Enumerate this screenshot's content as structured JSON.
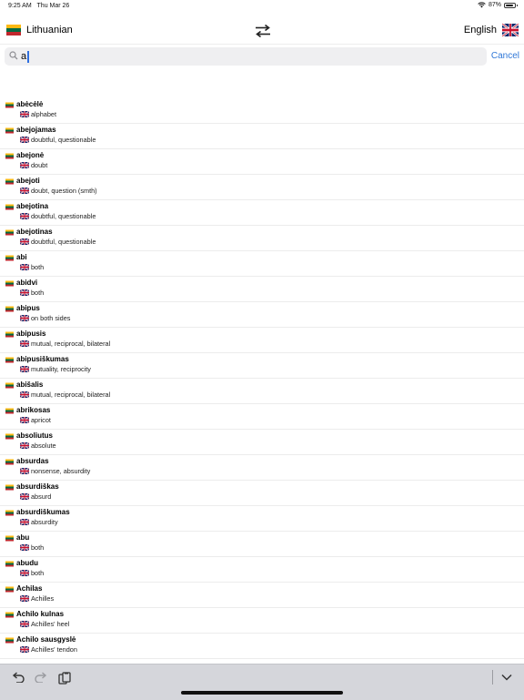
{
  "status_bar": {
    "time": "9:25 AM",
    "date": "Thu Mar 26",
    "battery": "87%",
    "battery_level": 0.87
  },
  "header": {
    "source_language": "Lithuanian",
    "target_language": "English",
    "swap_icon": "swap-arrows-icon"
  },
  "search": {
    "query": "a",
    "cancel_label": "Cancel",
    "icon": "search-icon"
  },
  "results": [
    {
      "term": "abėcėlė",
      "translation": "alphabet"
    },
    {
      "term": "abejojamas",
      "translation": "doubtful, questionable"
    },
    {
      "term": "abejonė",
      "translation": "doubt"
    },
    {
      "term": "abejoti",
      "translation": "doubt, question (smth)"
    },
    {
      "term": "abejotina",
      "translation": "doubtful, questionable"
    },
    {
      "term": "abejotinas",
      "translation": "doubtful, questionable"
    },
    {
      "term": "abi",
      "translation": "both"
    },
    {
      "term": "abidvi",
      "translation": "both"
    },
    {
      "term": "abipus",
      "translation": "on both sides"
    },
    {
      "term": "abipusis",
      "translation": "mutual, reciprocal, bilateral"
    },
    {
      "term": "abipusiškumas",
      "translation": "mutuality, reciprocity"
    },
    {
      "term": "abišalis",
      "translation": "mutual, reciprocal, bilateral"
    },
    {
      "term": "abrikosas",
      "translation": "apricot"
    },
    {
      "term": "absoliutus",
      "translation": "absolute"
    },
    {
      "term": "absurdas",
      "translation": "nonsense, absurdity"
    },
    {
      "term": "absurdiškas",
      "translation": "absurd"
    },
    {
      "term": "absurdiškumas",
      "translation": "absurdity"
    },
    {
      "term": "abu",
      "translation": "both"
    },
    {
      "term": "abudu",
      "translation": "both"
    },
    {
      "term": "Achilas",
      "translation": "Achilles"
    },
    {
      "term": "Achilo kulnas",
      "translation": "Achilles' heel"
    },
    {
      "term": "Achilo sausgyslė",
      "translation": "Achilles' tendon"
    }
  ],
  "keyboard_toolbar": {
    "undo_icon": "undo-icon",
    "redo_icon": "redo-icon",
    "paste_icon": "paste-icon",
    "dismiss_icon": "chevron-down-icon"
  },
  "colors": {
    "accent": "#2f77d7",
    "search_bg": "#efeff1",
    "toolbar_bg": "#d5d6db",
    "lt_yellow": "#fdb913",
    "lt_green": "#006a44",
    "lt_red": "#c1272d",
    "uk_blue": "#012169",
    "uk_red": "#c8102e"
  }
}
